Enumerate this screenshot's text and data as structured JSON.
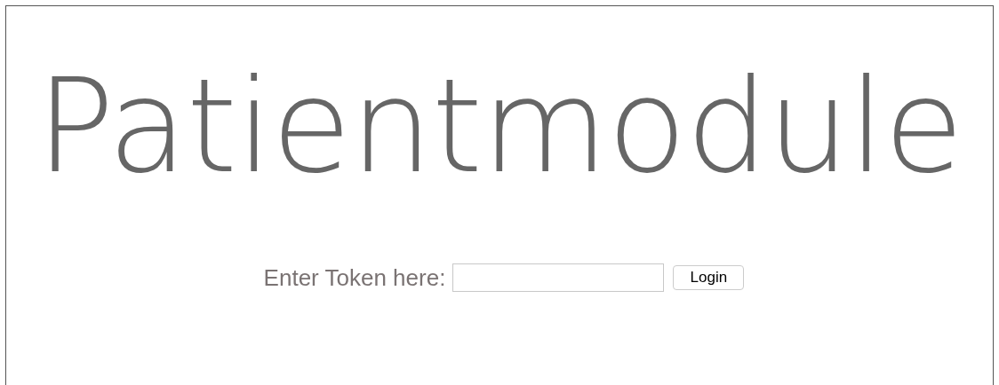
{
  "title": "Patientmodule",
  "login": {
    "label": "Enter Token here:",
    "button": "Login"
  }
}
